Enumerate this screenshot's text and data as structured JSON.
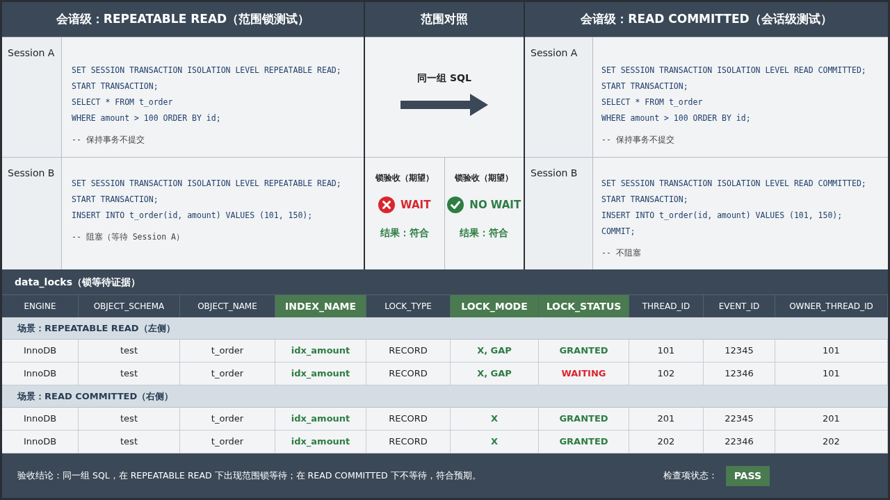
{
  "left_panel": {
    "title": "会谙级：REPEATABLE READ（范围锁测试）",
    "sessions": [
      {
        "label": "Session A",
        "lines": [
          {
            "kind": "code",
            "text": "SET SESSION TRANSACTION ISOLATION LEVEL REPEATABLE READ;"
          },
          {
            "kind": "code",
            "text": "START TRANSACTION;"
          },
          {
            "kind": "code",
            "text": "SELECT * FROM t_order"
          },
          {
            "kind": "code",
            "text": "WHERE amount > 100 ORDER BY id;"
          },
          {
            "kind": "comment",
            "text": "-- 保持事务不提交"
          }
        ]
      },
      {
        "label": "Session B",
        "lines": [
          {
            "kind": "code",
            "text": "SET SESSION TRANSACTION ISOLATION LEVEL REPEATABLE READ;"
          },
          {
            "kind": "code",
            "text": "START TRANSACTION;"
          },
          {
            "kind": "code",
            "text": "INSERT INTO t_order(id, amount) VALUES (101, 150);"
          },
          {
            "kind": "comment",
            "text": "-- 阻塞（等待 Session A）"
          }
        ]
      }
    ]
  },
  "middle_panel": {
    "title": "范围对照",
    "arrow_label": "同一组 SQL",
    "checks": [
      {
        "label": "锁验收（期望）",
        "kind": "fail",
        "text": "WAIT",
        "result": "结果：符合"
      },
      {
        "label": "锁验收（期望）",
        "kind": "pass",
        "text": "NO WAIT",
        "result": "结果：符合"
      }
    ]
  },
  "right_panel": {
    "title": "会谙级：READ COMMITTED（会话级测试）",
    "sessions": [
      {
        "label": "Session A",
        "lines": [
          {
            "kind": "code",
            "text": "SET SESSION TRANSACTION ISOLATION LEVEL READ COMMITTED;"
          },
          {
            "kind": "code",
            "text": "START TRANSACTION;"
          },
          {
            "kind": "code",
            "text": "SELECT * FROM t_order"
          },
          {
            "kind": "code",
            "text": "WHERE amount > 100 ORDER BY id;"
          },
          {
            "kind": "comment",
            "text": "-- 保持事务不提交"
          }
        ]
      },
      {
        "label": "Session B",
        "lines": [
          {
            "kind": "code",
            "text": "SET SESSION TRANSACTION ISOLATION LEVEL READ COMMITTED;"
          },
          {
            "kind": "code",
            "text": "START TRANSACTION;"
          },
          {
            "kind": "code",
            "text": "INSERT INTO t_order(id, amount) VALUES (101, 150);"
          },
          {
            "kind": "code",
            "text": "COMMIT;"
          },
          {
            "kind": "comment",
            "text": "-- 不阻塞"
          }
        ]
      }
    ]
  },
  "data_locks": {
    "title": "data_locks（锁等待证据）",
    "columns": [
      {
        "label": "ENGINE",
        "highlighted": false
      },
      {
        "label": "OBJECT_SCHEMA",
        "highlighted": false
      },
      {
        "label": "OBJECT_NAME",
        "highlighted": false
      },
      {
        "label": "INDEX_NAME",
        "highlighted": true
      },
      {
        "label": "LOCK_TYPE",
        "highlighted": false
      },
      {
        "label": "LOCK_MODE",
        "highlighted": true
      },
      {
        "label": "LOCK_STATUS",
        "highlighted": true
      },
      {
        "label": "THREAD_ID",
        "highlighted": false
      },
      {
        "label": "EVENT_ID",
        "highlighted": false
      },
      {
        "label": "OWNER_THREAD_ID",
        "highlighted": false
      }
    ],
    "groups": [
      {
        "title": "场景：REPEATABLE READ（左侧）",
        "rows": [
          {
            "waiting": false,
            "cells": [
              "InnoDB",
              "test",
              "t_order",
              "idx_amount",
              "RECORD",
              "X, GAP",
              "GRANTED",
              "101",
              "12345",
              "101"
            ]
          },
          {
            "waiting": true,
            "cells": [
              "InnoDB",
              "test",
              "t_order",
              "idx_amount",
              "RECORD",
              "X, GAP",
              "WAITING",
              "102",
              "12346",
              "101"
            ]
          }
        ]
      },
      {
        "title": "场景：READ COMMITTED（右侧）",
        "rows": [
          {
            "waiting": false,
            "cells": [
              "InnoDB",
              "test",
              "t_order",
              "idx_amount",
              "RECORD",
              "X",
              "GRANTED",
              "201",
              "22345",
              "201"
            ]
          },
          {
            "waiting": false,
            "cells": [
              "InnoDB",
              "test",
              "t_order",
              "idx_amount",
              "RECORD",
              "X",
              "GRANTED",
              "202",
              "22346",
              "202"
            ]
          }
        ]
      }
    ]
  },
  "footer": {
    "conclusion": "验收结论：同一组 SQL，在 REPEATABLE READ 下出现范围锁等待；在 READ COMMITTED 下不等待，符合预期。",
    "status_label": "检查项状态：",
    "status": "PASS",
    "passed": true
  }
}
